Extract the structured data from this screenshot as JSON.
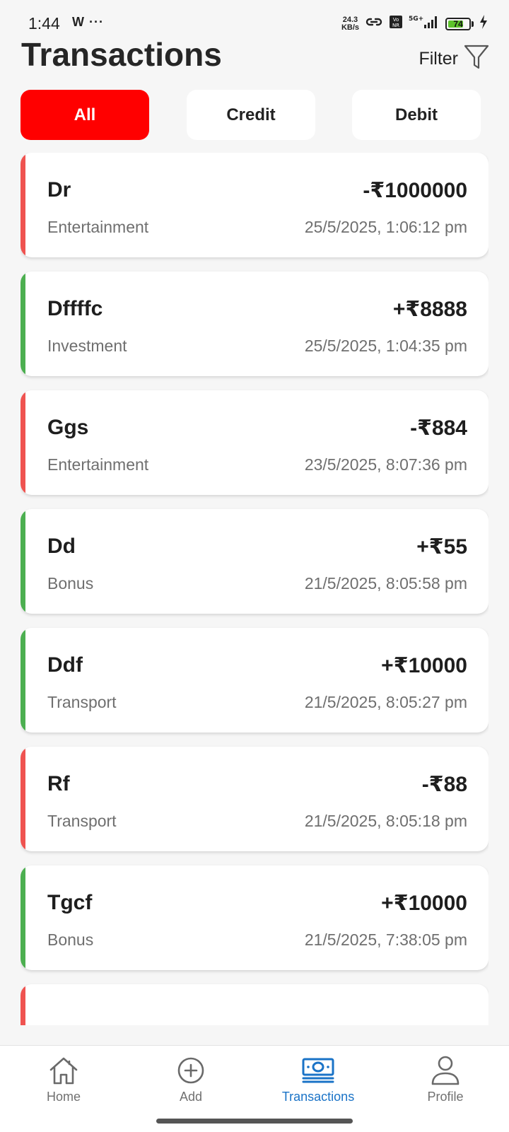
{
  "status_bar": {
    "time": "1:44",
    "extra": "W ···",
    "net_speed_value": "24.3",
    "net_speed_unit": "KB/s",
    "network": "5G+",
    "battery": "74"
  },
  "header": {
    "title": "Transactions",
    "filter_label": "Filter"
  },
  "tabs": [
    {
      "label": "All",
      "active": true
    },
    {
      "label": "Credit",
      "active": false
    },
    {
      "label": "Debit",
      "active": false
    }
  ],
  "colors": {
    "accent": "#ff0000",
    "credit": "#4caf50",
    "debit": "#ef5350",
    "nav_active": "#1a73c7"
  },
  "transactions": [
    {
      "title": "Dr",
      "amount": "-₹1000000",
      "category": "Entertainment",
      "timestamp": "25/5/2025, 1:06:12 pm",
      "type": "debit"
    },
    {
      "title": "Dffffc",
      "amount": "+₹8888",
      "category": "Investment",
      "timestamp": "25/5/2025, 1:04:35 pm",
      "type": "credit"
    },
    {
      "title": "Ggs",
      "amount": "-₹884",
      "category": "Entertainment",
      "timestamp": "23/5/2025, 8:07:36 pm",
      "type": "debit"
    },
    {
      "title": "Dd",
      "amount": "+₹55",
      "category": "Bonus",
      "timestamp": "21/5/2025, 8:05:58 pm",
      "type": "credit"
    },
    {
      "title": "Ddf",
      "amount": "+₹10000",
      "category": "Transport",
      "timestamp": "21/5/2025, 8:05:27 pm",
      "type": "credit"
    },
    {
      "title": "Rf",
      "amount": "-₹88",
      "category": "Transport",
      "timestamp": "21/5/2025, 8:05:18 pm",
      "type": "debit"
    },
    {
      "title": "Tgcf",
      "amount": "+₹10000",
      "category": "Bonus",
      "timestamp": "21/5/2025, 7:38:05 pm",
      "type": "credit"
    }
  ],
  "bottom_nav": [
    {
      "label": "Home",
      "icon": "home-icon",
      "active": false
    },
    {
      "label": "Add",
      "icon": "add-circle-icon",
      "active": false
    },
    {
      "label": "Transactions",
      "icon": "banknote-icon",
      "active": true
    },
    {
      "label": "Profile",
      "icon": "user-icon",
      "active": false
    }
  ]
}
